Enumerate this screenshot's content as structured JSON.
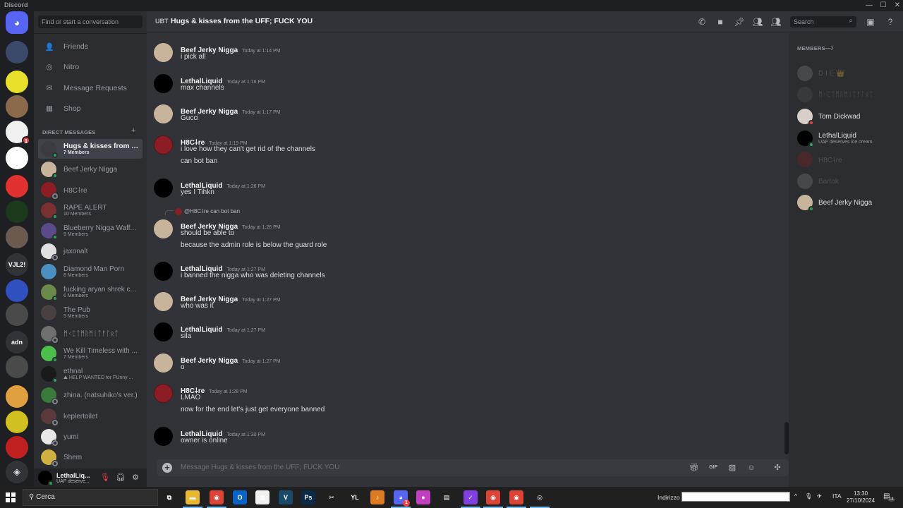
{
  "window": {
    "app_name": "Discord",
    "controls": [
      "minimize",
      "maximize",
      "close"
    ]
  },
  "guilds": [
    {
      "name": "discord-home",
      "label": "",
      "color": "#5865f2"
    },
    {
      "name": "server-1",
      "label": "",
      "color": "#3b4a6b"
    },
    {
      "name": "server-2",
      "label": "",
      "color": "#e8e02a"
    },
    {
      "name": "server-3",
      "label": "",
      "color": "#8a6a4a"
    },
    {
      "name": "server-4",
      "label": "",
      "color": "#f0f0f0",
      "badge": "1"
    },
    {
      "name": "server-5",
      "label": "",
      "color": "#ffffff"
    },
    {
      "name": "server-6",
      "label": "",
      "color": "#e03030"
    },
    {
      "name": "server-7",
      "label": "",
      "color": "#1b3a1b"
    },
    {
      "name": "server-8",
      "label": "",
      "color": "#6b5a50"
    },
    {
      "name": "server-9",
      "label": "VJL2!",
      "color": "#313338"
    },
    {
      "name": "server-10",
      "label": "",
      "color": "#3050c0"
    },
    {
      "name": "server-11",
      "label": "",
      "color": "#4a4a4a"
    },
    {
      "name": "server-12",
      "label": "adn",
      "color": "#313338"
    },
    {
      "name": "server-13",
      "label": "",
      "color": "#4a4a4a"
    },
    {
      "name": "server-14",
      "label": "",
      "color": "#e0a040"
    },
    {
      "name": "server-15",
      "label": "",
      "color": "#d0c020"
    },
    {
      "name": "server-16",
      "label": "",
      "color": "#c02020"
    },
    {
      "name": "discover",
      "label": "",
      "color": "#313338"
    }
  ],
  "dm_sidebar": {
    "search_placeholder": "Find or start a conversation",
    "nav": [
      {
        "label": "Friends",
        "icon": "friends-icon"
      },
      {
        "label": "Nitro",
        "icon": "nitro-icon"
      },
      {
        "label": "Message Requests",
        "icon": "envelope-icon"
      },
      {
        "label": "Shop",
        "icon": "shop-icon"
      }
    ],
    "header": "DIRECT MESSAGES",
    "dms": [
      {
        "name": "Hugs & kisses from th...",
        "sub": "7 Members",
        "status": "online",
        "active": true,
        "color": "#3a3c42"
      },
      {
        "name": "Beef Jerky Nigga",
        "sub": "",
        "status": "online",
        "color": "#c8b49a"
      },
      {
        "name": "H8C⸸re",
        "sub": "",
        "status": "offline",
        "color": "#8b1d24"
      },
      {
        "name": "RAPE ALERT",
        "sub": "10 Members",
        "status": "online",
        "color": "#7a3030"
      },
      {
        "name": "Blueberry Nigga Waff...",
        "sub": "9 Members",
        "status": "online",
        "color": "#5a4a8a"
      },
      {
        "name": "jaxonalt",
        "sub": "",
        "status": "offline",
        "color": "#e0e0e0"
      },
      {
        "name": "Diamond Man Porn",
        "sub": "8 Members",
        "status": "",
        "color": "#4a90c0"
      },
      {
        "name": "fucking aryan shrek c...",
        "sub": "6 Members",
        "status": "online",
        "color": "#6a8a4a"
      },
      {
        "name": "The Pub",
        "sub": "5 Members",
        "status": "",
        "color": "#4a4040"
      },
      {
        "name": "ᛗᚲᛈᛏᛗᚱᛗᛁᛏᚠᛚᛟᛏ",
        "sub": "",
        "status": "offline",
        "color": "#707070"
      },
      {
        "name": "We Kill Timeless with ...",
        "sub": "7 Members",
        "status": "online",
        "color": "#4ac04a"
      },
      {
        "name": "ethnal",
        "sub": "⛰ HELP WANTED for FUnny ...",
        "status": "online",
        "color": "#1a1a1a"
      },
      {
        "name": "zhina. (natsuhiko's ver.)",
        "sub": "",
        "status": "offline",
        "color": "#3a7a3a"
      },
      {
        "name": "keplertoilet",
        "sub": "",
        "status": "offline",
        "color": "#5a3a3a"
      },
      {
        "name": "yumi",
        "sub": "",
        "status": "offline",
        "color": "#e8e8e8"
      },
      {
        "name": "Shem",
        "sub": "",
        "status": "offline",
        "color": "#d0b040"
      }
    ]
  },
  "user_panel": {
    "name": "LethalLiq...",
    "status_text": "UAF deserve...",
    "status": "online",
    "mute_label": "mic-muted",
    "deafen_label": "headphones",
    "settings_label": "settings"
  },
  "channel": {
    "title": "Hugs & kisses from the UFF; FUCK YOU",
    "search_placeholder": "Search",
    "composer_placeholder": "Message Hugs & kisses from the UFF; FUCK YOU"
  },
  "messages": [
    {
      "author": "Beef Jerky Nigga",
      "time": "Today at 1:14 PM",
      "lines": [
        "i pick all"
      ],
      "avatar_color": "#c8b49a"
    },
    {
      "author": "LethalLiquid",
      "time": "Today at 1:16 PM",
      "lines": [
        "max channels"
      ],
      "avatar_color": "#000000"
    },
    {
      "author": "Beef Jerky Nigga",
      "time": "Today at 1:17 PM",
      "lines": [
        "Gucci"
      ],
      "avatar_color": "#c8b49a"
    },
    {
      "author": "H8C⸸re",
      "time": "Today at 1:19 PM",
      "lines": [
        "i love how they can't get rid of the channels",
        "can bot ban"
      ],
      "avatar_color": "#8b1d24"
    },
    {
      "author": "LethalLiquid",
      "time": "Today at 1:26 PM",
      "lines": [
        "yes I Tihkn"
      ],
      "avatar_color": "#000000"
    },
    {
      "author": "Beef Jerky Nigga",
      "time": "Today at 1:26 PM",
      "lines": [
        "should be able to",
        "because the admin role is below the guard role"
      ],
      "avatar_color": "#c8b49a",
      "reply": {
        "author": "@H8C⸸re",
        "text": "can bot ban"
      }
    },
    {
      "author": "LethalLiquid",
      "time": "Today at 1:27 PM",
      "lines": [
        "i banned the nigga who was deleting channels"
      ],
      "avatar_color": "#000000"
    },
    {
      "author": "Beef Jerky Nigga",
      "time": "Today at 1:27 PM",
      "lines": [
        "who was it"
      ],
      "avatar_color": "#c8b49a"
    },
    {
      "author": "LethalLiquid",
      "time": "Today at 1:27 PM",
      "lines": [
        "sila"
      ],
      "avatar_color": "#000000"
    },
    {
      "author": "Beef Jerky Nigga",
      "time": "Today at 1:27 PM",
      "lines": [
        "o"
      ],
      "avatar_color": "#c8b49a"
    },
    {
      "author": "H8C⸸re",
      "time": "Today at 1:28 PM",
      "lines": [
        "LMAO",
        "now for the end let's just get everyone banned"
      ],
      "avatar_color": "#8b1d24"
    },
    {
      "author": "LethalLiquid",
      "time": "Today at 1:30 PM",
      "lines": [
        "owner is online"
      ],
      "avatar_color": "#000000"
    }
  ],
  "members": {
    "header": "MEMBERS—7",
    "list": [
      {
        "name": "D I E 👑",
        "sub": "",
        "status": "offline",
        "color": "#888888"
      },
      {
        "name": "ᛗᚲᛈᛏᛗᚱᛗᛁᛏᚠᛚᛟᛏ",
        "sub": "",
        "status": "offline",
        "color": "#555555"
      },
      {
        "name": "Tom Dickwad",
        "sub": "",
        "status": "dnd",
        "color": "#d8d0c8"
      },
      {
        "name": "LethalLiquid",
        "sub": "UAF deserves ice cream.",
        "status": "online",
        "color": "#000000"
      },
      {
        "name": "H8C⸸re",
        "sub": "",
        "status": "offline",
        "color": "#8b1d24"
      },
      {
        "name": "Bartok",
        "sub": "",
        "status": "offline",
        "color": "#888888"
      },
      {
        "name": "Beef Jerky Nigga",
        "sub": "",
        "status": "online",
        "color": "#c8b49a"
      }
    ]
  },
  "taskbar": {
    "search_placeholder": "Cerca",
    "apps": [
      {
        "name": "task-view",
        "glyph": "⧉",
        "color": "transparent"
      },
      {
        "name": "file-explorer",
        "glyph": "▬",
        "color": "#e8b830",
        "open": true
      },
      {
        "name": "chrome",
        "glyph": "◉",
        "color": "#db4437",
        "open": true
      },
      {
        "name": "outlook",
        "glyph": "O",
        "color": "#0a64c8"
      },
      {
        "name": "ms-store",
        "glyph": "▦",
        "color": "#f0f0f0"
      },
      {
        "name": "vegas",
        "glyph": "V",
        "color": "#1a4a6a"
      },
      {
        "name": "photoshop",
        "glyph": "Ps",
        "color": "#0a2a4a"
      },
      {
        "name": "app-1",
        "glyph": "✂",
        "color": "transparent"
      },
      {
        "name": "app-2",
        "glyph": "YL",
        "color": "transparent"
      },
      {
        "name": "fl-studio",
        "glyph": "♪",
        "color": "#e07a20"
      },
      {
        "name": "discord",
        "glyph": "◕",
        "color": "#5865f2",
        "open": true,
        "badge": "1"
      },
      {
        "name": "app-3",
        "glyph": "●",
        "color": "#c040c0"
      },
      {
        "name": "app-4",
        "glyph": "▤",
        "color": "transparent"
      },
      {
        "name": "app-5",
        "glyph": "✓",
        "color": "#8040e0",
        "open": true
      },
      {
        "name": "chrome-profile-l",
        "glyph": "◉",
        "color": "#db4437",
        "open": true
      },
      {
        "name": "chrome-profile-a",
        "glyph": "◉",
        "color": "#db4437",
        "open": true
      },
      {
        "name": "app-6",
        "glyph": "◎",
        "color": "transparent",
        "open": true
      }
    ],
    "address_label": "Indirizzo",
    "language": "ITA",
    "time": "13:30",
    "date": "27/10/2024",
    "notifications": "14"
  }
}
